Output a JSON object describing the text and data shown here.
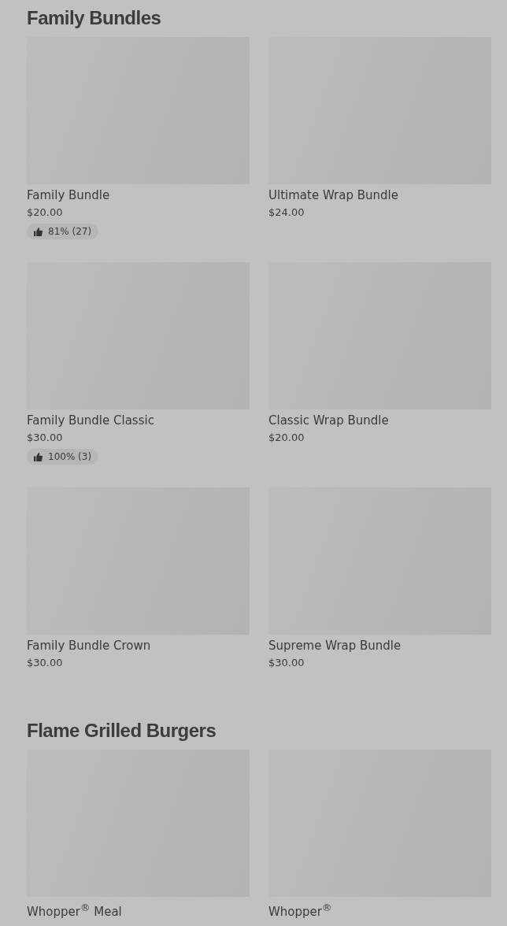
{
  "sections": [
    {
      "title": "Family Bundles",
      "items": [
        {
          "name": "Family Bundle",
          "price": "$20.00",
          "rating": "81% (27)"
        },
        {
          "name": "Ultimate Wrap Bundle",
          "price": "$24.00"
        },
        {
          "name": "Family Bundle Classic",
          "price": "$30.00",
          "rating": "100% (3)"
        },
        {
          "name": "Classic Wrap Bundle",
          "price": "$20.00"
        },
        {
          "name": "Family Bundle Crown",
          "price": "$30.00"
        },
        {
          "name": "Supreme Wrap Bundle",
          "price": "$30.00"
        }
      ]
    },
    {
      "title": "Flame Grilled Burgers",
      "items": [
        {
          "name": "Whopper$^{®}$ Meal"
        },
        {
          "name": "Whopper$^{®}$"
        }
      ]
    }
  ]
}
